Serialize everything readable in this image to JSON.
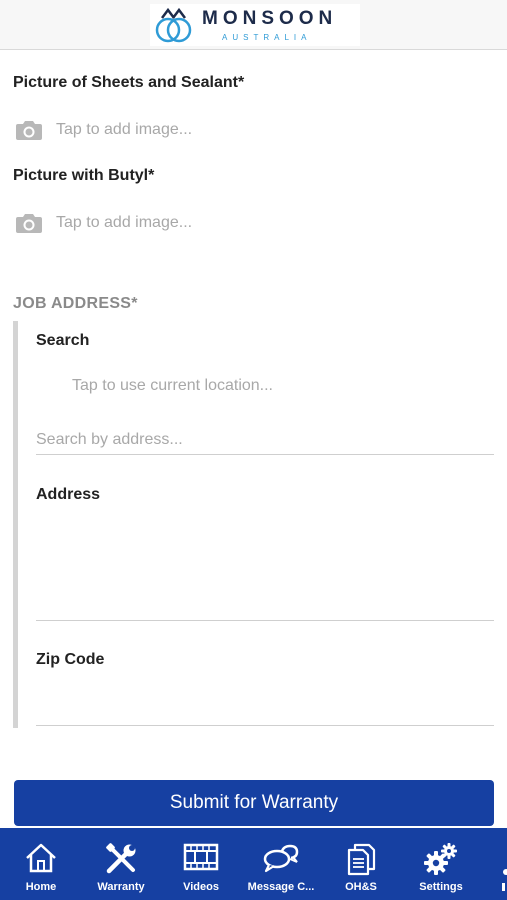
{
  "header": {
    "brand": "MONSOON",
    "brand_sub": "AUSTRALIA"
  },
  "form": {
    "sheets_label": "Picture of Sheets and Sealant*",
    "sheets_hint": "Tap to add image...",
    "butyl_label": "Picture with Butyl*",
    "butyl_hint": "Tap to add image...",
    "job_address_title": "JOB ADDRESS*",
    "search_label": "Search",
    "location_hint": "Tap to use current location...",
    "search_placeholder": "Search by address...",
    "address_label": "Address",
    "zip_label": "Zip Code",
    "submit_label": "Submit for Warranty"
  },
  "tabs": [
    {
      "label": "Home",
      "icon": "home-icon"
    },
    {
      "label": "Warranty",
      "icon": "tools-icon"
    },
    {
      "label": "Videos",
      "icon": "film-icon"
    },
    {
      "label": "Message C...",
      "icon": "chat-icon"
    },
    {
      "label": "OH&S",
      "icon": "documents-icon"
    },
    {
      "label": "Settings",
      "icon": "gears-icon"
    }
  ],
  "colors": {
    "brand_blue": "#1640a2",
    "logo_light_blue": "#2f9bd6",
    "logo_dark": "#1d2b4a"
  }
}
